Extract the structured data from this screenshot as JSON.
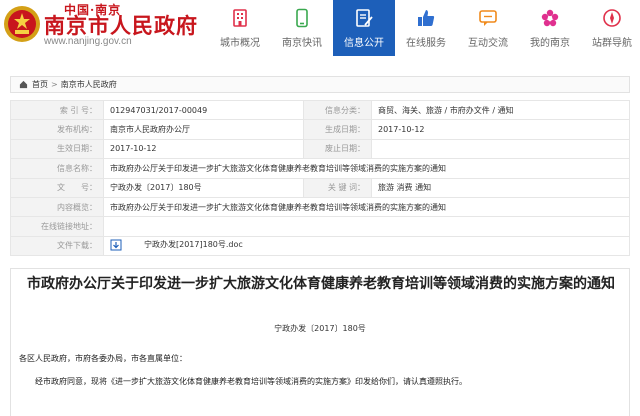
{
  "site": {
    "logo_small": "中国·南京",
    "logo_big": "南京市人民政府",
    "url": "www.nanjing.gov.cn"
  },
  "nav": [
    {
      "label": "城市概况",
      "icon": "building-icon",
      "active": false
    },
    {
      "label": "南京快讯",
      "icon": "mobile-icon",
      "active": false
    },
    {
      "label": "信息公开",
      "icon": "document-edit-icon",
      "active": true
    },
    {
      "label": "在线服务",
      "icon": "thumbs-up-icon",
      "active": false
    },
    {
      "label": "互动交流",
      "icon": "chat-icon",
      "active": false
    },
    {
      "label": "我的南京",
      "icon": "flower-icon",
      "active": false
    },
    {
      "label": "站群导航",
      "icon": "compass-icon",
      "active": false
    }
  ],
  "breadcrumb": {
    "home": "首页",
    "separator": ">",
    "current": "南京市人民政府"
  },
  "info": {
    "index_label": "索 引 号：",
    "index_value": "012947031/2017-00049",
    "category_label": "信息分类：",
    "category_value": "商贸、海关、旅游 / 市府办文件 / 通知",
    "publisher_label": "发布机构：",
    "publisher_value": "南京市人民政府办公厅",
    "created_label": "生成日期：",
    "created_value": "2017-10-12",
    "effective_label": "生效日期：",
    "effective_value": "2017-10-12",
    "abolished_label": "废止日期：",
    "abolished_value": "",
    "name_label": "信息名称：",
    "name_value": "市政府办公厅关于印发进一步扩大旅游文化体育健康养老教育培训等领域消费的实施方案的通知",
    "docno_label": "文　　号：",
    "docno_value": "宁政办发〔2017〕180号",
    "keywords_label": "关 键 词：",
    "keywords_value": "旅游 消费 通知",
    "summary_label": "内容概览：",
    "summary_value": "市政府办公厅关于印发进一步扩大旅游文化体育健康养老教育培训等领域消费的实施方案的通知",
    "link_label": "在线链接地址：",
    "link_value": "",
    "download_label": "文件下载：",
    "download_value": "宁政办发[2017]180号.doc"
  },
  "article": {
    "title": "市政府办公厅关于印发进一步扩大旅游文化体育健康养老教育培训等领域消费的实施方案的通知",
    "doc_number": "宁政办发〔2017〕180号",
    "salutation": "各区人民政府，市府各委办局，市各直属单位：",
    "body_line1": "经市政府同意，现将《进一步扩大旅游文化体育健康养老教育培训等领域消费的实施方案》印发给你们，请认真遵照执行。"
  },
  "colors": {
    "brand_red": "#c8161d",
    "nav_active": "#1d5fb9",
    "nav_icon": "#e0304a"
  }
}
